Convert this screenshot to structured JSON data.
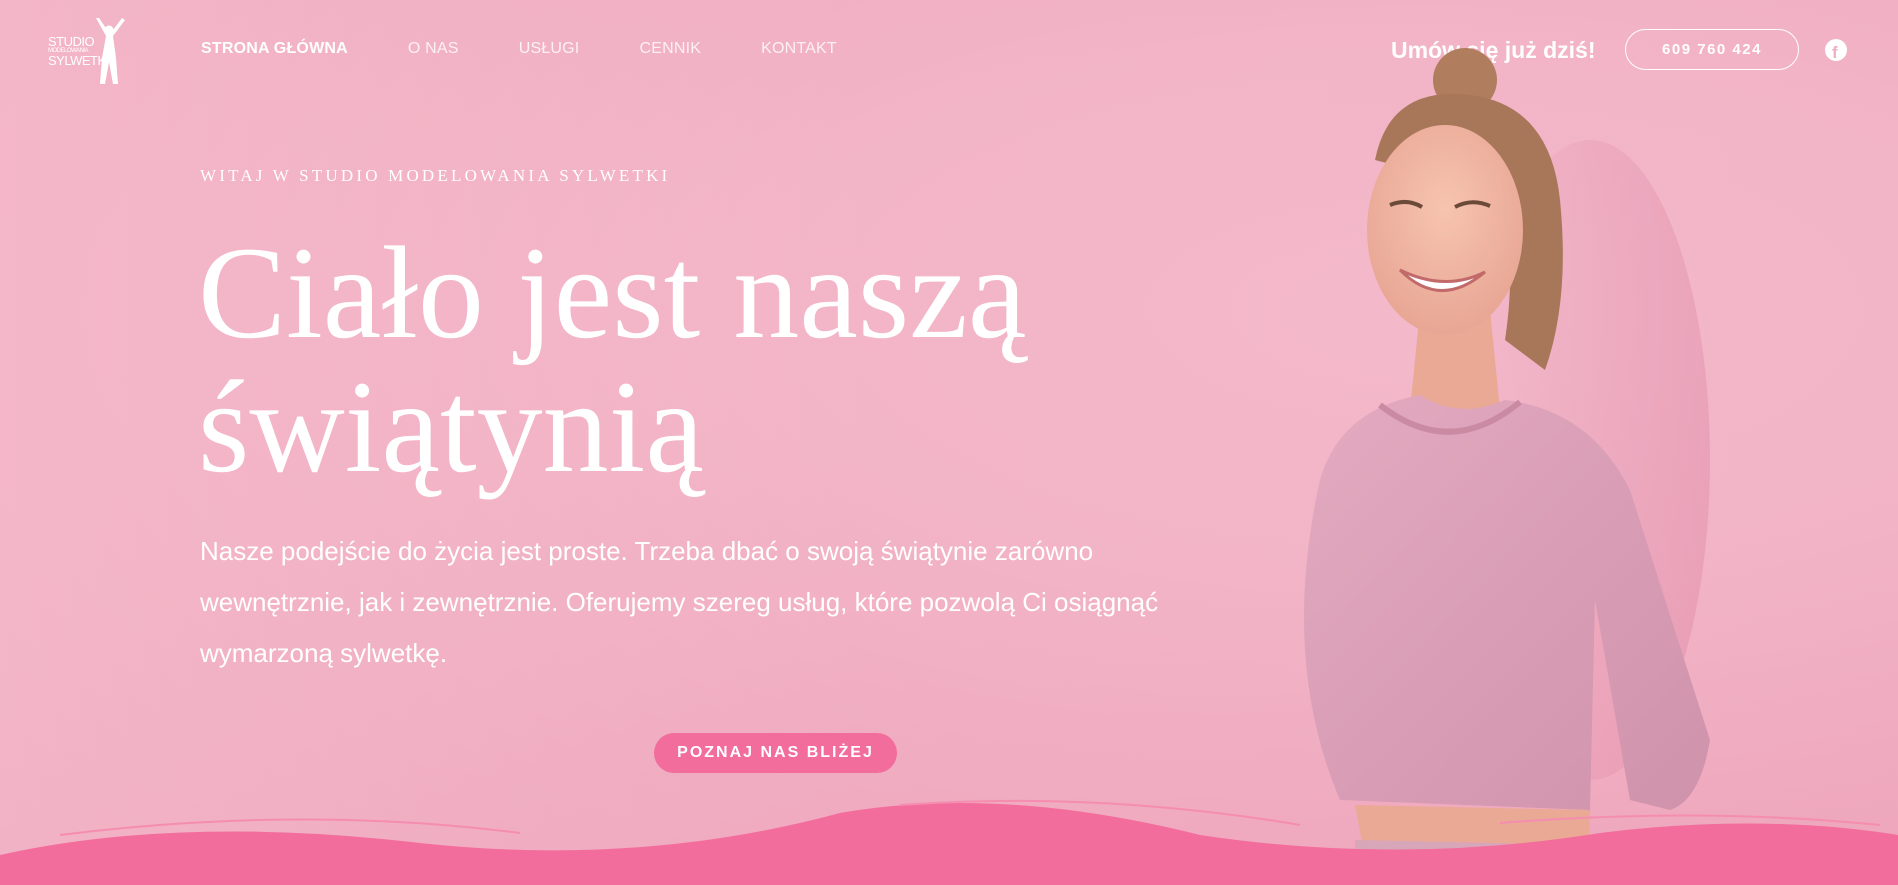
{
  "header": {
    "logo_text": [
      "STUDIO",
      "MODELOWANIA",
      "SYLWETKI"
    ],
    "nav": [
      {
        "label": "STRONA GŁÓWNA",
        "active": true
      },
      {
        "label": "O NAS",
        "active": false
      },
      {
        "label": "USŁUGI",
        "active": false
      },
      {
        "label": "CENNIK",
        "active": false
      },
      {
        "label": "KONTAKT",
        "active": false
      }
    ],
    "cta_text": "Umów się już dziś!",
    "phone": "609 760 424",
    "social_icon": "facebook-icon"
  },
  "hero": {
    "eyebrow": "WITAJ W STUDIO MODELOWANIA SYLWETKI",
    "headline_line1": "Ciało jest naszą",
    "headline_line2": "świątynią",
    "lead": "Nasze podejście do życia jest proste. Trzeba dbać o swoją świątynie zarówno wewnętrznie, jak i zewnętrznie. Oferujemy szereg usług, które pozwolą Ci osiągnąć wymarzoną sylwetkę.",
    "button_label": "POZNAJ NAS BLIŻEJ"
  },
  "colors": {
    "background": "#f2b3c6",
    "accent": "#f36d9c",
    "text": "#ffffff"
  }
}
